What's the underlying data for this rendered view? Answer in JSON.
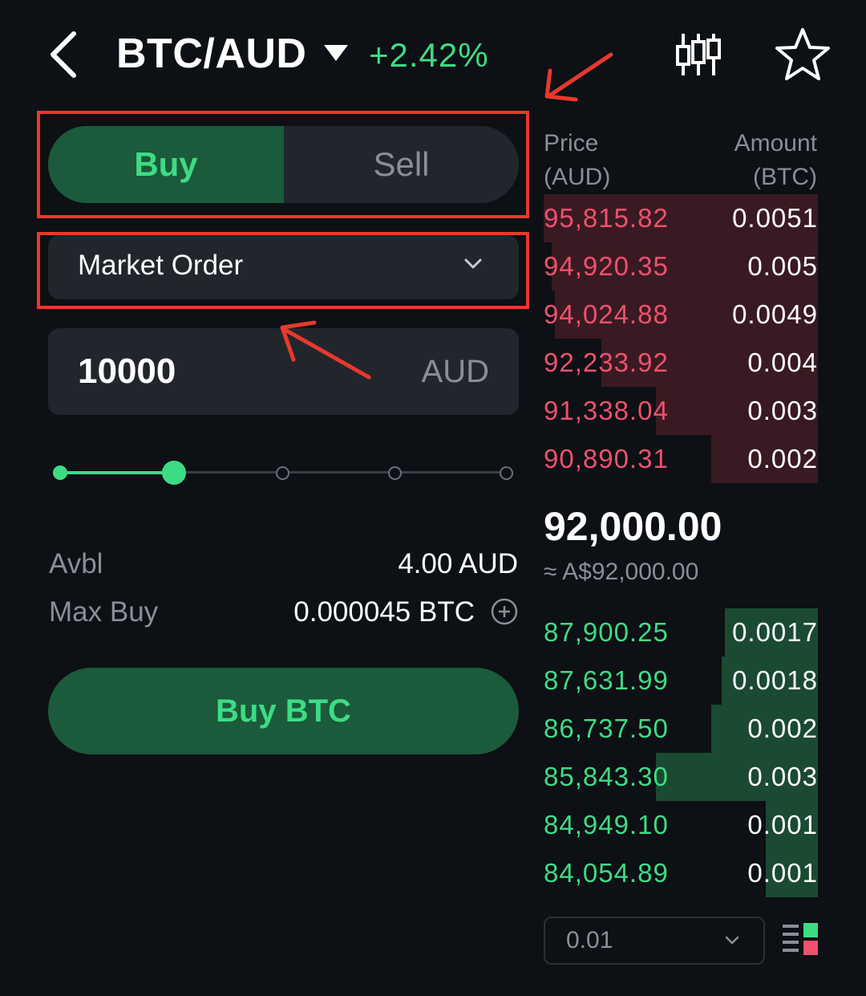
{
  "header": {
    "pair": "BTC/AUD",
    "change": "+2.42%",
    "icons": [
      "back-icon",
      "pair-dropdown-icon",
      "chart-icon",
      "star-icon"
    ]
  },
  "trade": {
    "buy_label": "Buy",
    "sell_label": "Sell",
    "order_type": "Market Order",
    "amount_value": "10000",
    "amount_unit": "AUD",
    "slider_level_percent": 25
  },
  "info": {
    "avbl_label": "Avbl",
    "avbl_value": "4.00 AUD",
    "maxbuy_label": "Max Buy",
    "maxbuy_value": "0.000045 BTC"
  },
  "buy_button": "Buy BTC",
  "orderbook": {
    "price_header": [
      "Price",
      "(AUD)"
    ],
    "amount_header": [
      "Amount",
      "(BTC)"
    ],
    "asks": [
      {
        "price": "95,815.82",
        "amount": "0.0051",
        "depth": 1.0
      },
      {
        "price": "94,920.35",
        "amount": "0.005",
        "depth": 0.97
      },
      {
        "price": "94,024.88",
        "amount": "0.0049",
        "depth": 0.96
      },
      {
        "price": "92,233.92",
        "amount": "0.004",
        "depth": 0.79
      },
      {
        "price": "91,338.04",
        "amount": "0.003",
        "depth": 0.59
      },
      {
        "price": "90,890.31",
        "amount": "0.002",
        "depth": 0.39
      }
    ],
    "mid_price": "92,000.00",
    "mid_sub": "≈ A$92,000.00",
    "bids": [
      {
        "price": "87,900.25",
        "amount": "0.0017",
        "depth": 0.34
      },
      {
        "price": "87,631.99",
        "amount": "0.0018",
        "depth": 0.35
      },
      {
        "price": "86,737.50",
        "amount": "0.002",
        "depth": 0.39
      },
      {
        "price": "85,843.30",
        "amount": "0.003",
        "depth": 0.59
      },
      {
        "price": "84,949.10",
        "amount": "0.001",
        "depth": 0.19
      },
      {
        "price": "84,054.89",
        "amount": "0.001",
        "depth": 0.19
      }
    ],
    "precision": "0.01"
  },
  "colors": {
    "buy_green": "#3ddc84",
    "sell_red": "#f0506e",
    "annotation_red": "#e8392c"
  }
}
